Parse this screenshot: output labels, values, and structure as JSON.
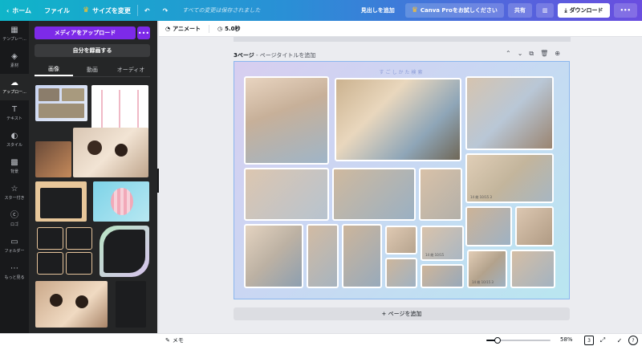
{
  "topbar": {
    "home": "ホーム",
    "file": "ファイル",
    "resize": "サイズを変更",
    "save_status": "すべての変更は保存されました",
    "add_heading": "見出しを追加",
    "canva_pro": "Canva Proをお試しください",
    "share": "共有",
    "download": "ダウンロード"
  },
  "rail": {
    "items": [
      {
        "label": "テンプレー...",
        "icon": "template-icon"
      },
      {
        "label": "素材",
        "icon": "elements-icon"
      },
      {
        "label": "アップロー...",
        "icon": "upload-icon"
      },
      {
        "label": "テキスト",
        "icon": "text-icon"
      },
      {
        "label": "スタイル",
        "icon": "style-icon"
      },
      {
        "label": "背景",
        "icon": "background-icon"
      },
      {
        "label": "スター付き",
        "icon": "star-icon"
      },
      {
        "label": "ロゴ",
        "icon": "logo-icon"
      },
      {
        "label": "フォルダー",
        "icon": "folder-icon"
      },
      {
        "label": "もっと見る",
        "icon": "more-icon"
      }
    ]
  },
  "panel": {
    "upload_label": "メディアをアップロード",
    "more_label": "•••",
    "record_label": "自分を録画する",
    "tabs": [
      {
        "label": "画像"
      },
      {
        "label": "動画"
      },
      {
        "label": "オーディオ"
      }
    ]
  },
  "editor": {
    "animate": "アニメート",
    "duration": "5.0秒"
  },
  "canvas": {
    "page_number": "3ページ",
    "page_title_placeholder": " - ページタイトルを追加",
    "page_heading": "すごしかた検索",
    "add_page": "+ ページを追加",
    "captions": [
      "14 総 10/15 3",
      "14 総 10/15",
      "14 総 10/15 3"
    ]
  },
  "bottombar": {
    "memo": "メモ",
    "zoom": "58%",
    "zoom_fraction": 0.17,
    "page_count": "3"
  },
  "colors": {
    "accent": "#7d2ae8",
    "crown": "#ffc22a"
  }
}
